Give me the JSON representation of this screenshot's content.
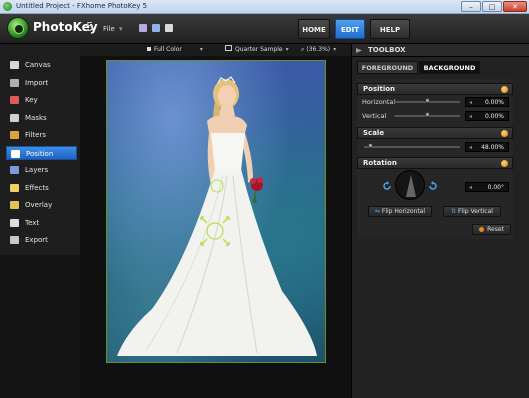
{
  "window": {
    "title": "Untitled Project - FXhome PhotoKey 5",
    "min": "–",
    "max": "□",
    "close": "✕"
  },
  "app": {
    "logo_text": "PhotoKey",
    "logo_version": "5",
    "file_menu": "File",
    "file_chevron": "▾"
  },
  "nav": {
    "home": "HOME",
    "edit": "EDIT",
    "help": "HELP"
  },
  "sidebar": {
    "items": [
      {
        "label": "Canvas",
        "icon": "canvas-icon",
        "color": "#d8d8d8"
      },
      {
        "label": "Import",
        "icon": "import-icon",
        "color": "#b0b0b0"
      },
      {
        "label": "Key",
        "icon": "key-icon",
        "color": "#e05a5a"
      },
      {
        "label": "Masks",
        "icon": "masks-icon",
        "color": "#d0d0d0"
      },
      {
        "label": "Filters",
        "icon": "filters-icon",
        "color": "#e0a040"
      },
      {
        "label": "Position",
        "icon": "position-icon",
        "color": "#ffffff"
      },
      {
        "label": "Layers",
        "icon": "layers-icon",
        "color": "#7a9ad8"
      },
      {
        "label": "Effects",
        "icon": "effects-icon",
        "color": "#f0d060"
      },
      {
        "label": "Overlay",
        "icon": "overlay-icon",
        "color": "#e8c05a"
      },
      {
        "label": "Text",
        "icon": "text-icon",
        "color": "#dddddd"
      },
      {
        "label": "Export",
        "icon": "export-icon",
        "color": "#c8c8c8"
      }
    ],
    "active_index": 5
  },
  "canvas_toolbar": {
    "color_mode": "Full Color",
    "sample": "Quarter Sample",
    "zoom": "(36.3%)",
    "chevron": "▾"
  },
  "toolbox": {
    "title": "TOOLBOX",
    "tabs": [
      "FOREGROUND",
      "BACKGROUND"
    ],
    "active_tab": 1,
    "position": {
      "title": "Position",
      "horizontal_label": "Horizontal",
      "horizontal_value": "0.00%",
      "vertical_label": "Vertical",
      "vertical_value": "0.00%"
    },
    "scale": {
      "title": "Scale",
      "value": "48.00%"
    },
    "rotation": {
      "title": "Rotation",
      "value": "0.00°",
      "flip_horizontal": "Flip Horizontal",
      "flip_vertical": "Flip Vertical"
    },
    "reset": "Reset",
    "arrow": "◂"
  },
  "colors": {
    "accent": "#2a7bd8",
    "section_dot": "#e8891a"
  }
}
